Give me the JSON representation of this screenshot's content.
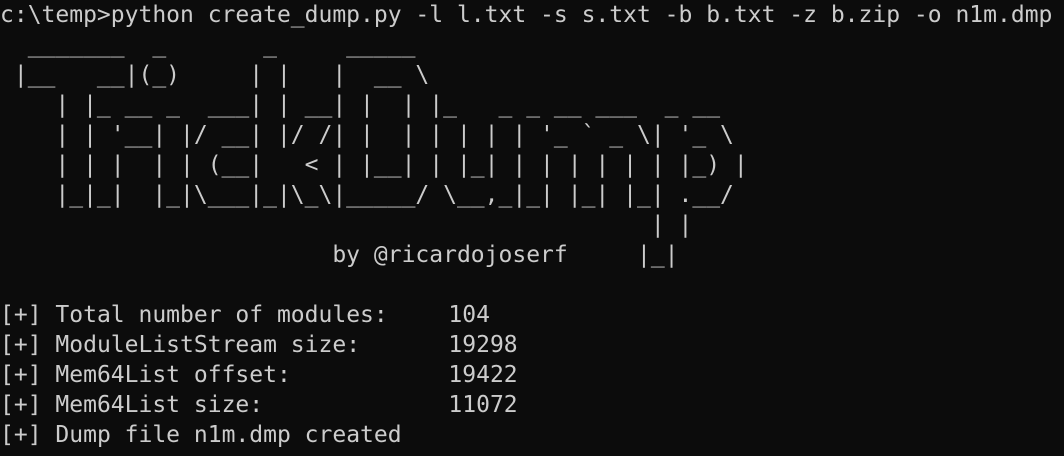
{
  "terminal": {
    "prompt": "c:\\temp>",
    "command": "python create_dump.py -l l.txt -s s.txt -b b.txt -z b.zip -o n1m.dmp"
  },
  "banner": {
    "lines": [
      "  _______  _       _     _____",
      " |__   __|(_)     | |   |  __ \\",
      "    | |_ __ _  ___| | __| |  | |_   _ _ __ ___  _ __",
      "    | | '__| |/ __| |/ /| |  | | | | | '_ ` _ \\| '_ \\",
      "    | | |  | | (__|   < | |__| | |_| | | | | | | |_) |",
      "    |_|_|  |_|\\___|_|\\_\\|_____/ \\__,_|_| |_| |_| .__/",
      "                                               | |",
      "                        by @ricardojoserf     |_|"
    ]
  },
  "output": {
    "items": [
      {
        "prefix": "[+]",
        "label": "Total number of modules:",
        "value": "104"
      },
      {
        "prefix": "[+]",
        "label": "ModuleListStream size:",
        "value": "19298"
      },
      {
        "prefix": "[+]",
        "label": "Mem64List offset:",
        "value": "19422"
      },
      {
        "prefix": "[+]",
        "label": "Mem64List size:",
        "value": "11072"
      }
    ],
    "final": {
      "prefix": "[+]",
      "text": "Dump file n1m.dmp created"
    }
  },
  "colors": {
    "background": "#0c0c0c",
    "foreground": "#cccccc"
  }
}
